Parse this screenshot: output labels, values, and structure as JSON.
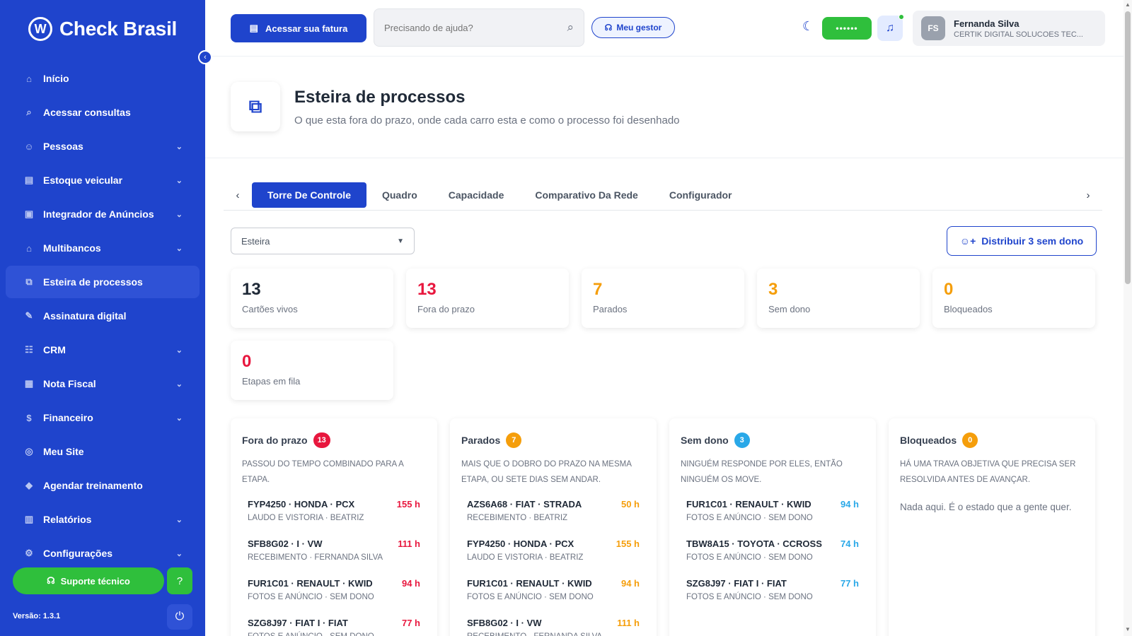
{
  "brand": {
    "name": "Check Brasil",
    "logo_letter": "W"
  },
  "sidebar": {
    "items": [
      {
        "label": "Início",
        "icon": "home-icon",
        "glyph": "⌂",
        "has_chevron": false,
        "active": false
      },
      {
        "label": "Acessar consultas",
        "icon": "search-icon",
        "glyph": "⌕",
        "has_chevron": false,
        "active": false
      },
      {
        "label": "Pessoas",
        "icon": "people-icon",
        "glyph": "☺",
        "has_chevron": true,
        "active": false
      },
      {
        "label": "Estoque veicular",
        "icon": "car-icon",
        "glyph": "▤",
        "has_chevron": true,
        "active": false
      },
      {
        "label": "Integrador de Anúncios",
        "icon": "ads-icon",
        "glyph": "▣",
        "has_chevron": true,
        "active": false
      },
      {
        "label": "Multibancos",
        "icon": "bank-icon",
        "glyph": "⌂",
        "has_chevron": true,
        "active": false
      },
      {
        "label": "Esteira de processos",
        "icon": "process-icon",
        "glyph": "⧉",
        "has_chevron": false,
        "active": true
      },
      {
        "label": "Assinatura digital",
        "icon": "signature-icon",
        "glyph": "✎",
        "has_chevron": false,
        "active": false
      },
      {
        "label": "CRM",
        "icon": "crm-icon",
        "glyph": "☷",
        "has_chevron": true,
        "active": false
      },
      {
        "label": "Nota Fiscal",
        "icon": "invoice-icon",
        "glyph": "▦",
        "has_chevron": true,
        "active": false
      },
      {
        "label": "Financeiro",
        "icon": "finance-icon",
        "glyph": "$",
        "has_chevron": true,
        "active": false
      },
      {
        "label": "Meu Site",
        "icon": "globe-icon",
        "glyph": "◎",
        "has_chevron": false,
        "active": false
      },
      {
        "label": "Agendar treinamento",
        "icon": "training-icon",
        "glyph": "◆",
        "has_chevron": false,
        "active": false
      },
      {
        "label": "Relatórios",
        "icon": "reports-icon",
        "glyph": "▥",
        "has_chevron": true,
        "active": false
      },
      {
        "label": "Configurações",
        "icon": "settings-icon",
        "glyph": "⚙",
        "has_chevron": true,
        "active": false
      }
    ],
    "support_label": "Suporte técnico",
    "version": "Versão: 1.3.1"
  },
  "topbar": {
    "invoice_label": "Acessar sua fatura",
    "search_placeholder": "Precisando de ajuda?",
    "manager_label": "Meu gestor",
    "masked_value": "••••••",
    "user": {
      "initials": "FS",
      "name": "Fernanda Silva",
      "company": "CERTIK DIGITAL SOLUCOES TEC..."
    }
  },
  "page": {
    "title": "Esteira de processos",
    "subtitle": "O que esta fora do prazo, onde cada carro esta e como o processo foi desenhado"
  },
  "tabs": [
    "Torre De Controle",
    "Quadro",
    "Capacidade",
    "Comparativo Da Rede",
    "Configurador"
  ],
  "active_tab": 0,
  "filters": {
    "select_value": "Esteira",
    "distribute_label": "Distribuir 3 sem dono"
  },
  "colors": {
    "primary": "#1f44cc",
    "green": "#2fbf3c",
    "red": "#e8173e",
    "orange": "#f59e0b",
    "blue": "#29a8e8",
    "dark": "#1f2937"
  },
  "kpis": [
    {
      "value": "13",
      "label": "Cartões vivos",
      "color": "#1f2937"
    },
    {
      "value": "13",
      "label": "Fora do prazo",
      "color": "#e8173e"
    },
    {
      "value": "7",
      "label": "Parados",
      "color": "#f59e0b"
    },
    {
      "value": "3",
      "label": "Sem dono",
      "color": "#f59e0b"
    },
    {
      "value": "0",
      "label": "Bloqueados",
      "color": "#f59e0b"
    },
    {
      "value": "0",
      "label": "Etapas em fila",
      "color": "#e8173e"
    }
  ],
  "columns": [
    {
      "title": "Fora do prazo",
      "count": "13",
      "color": "#e8173e",
      "desc": "Passou do tempo combinado para a etapa.",
      "items": [
        {
          "title": "FYP4250 · HONDA · PCX",
          "sub": "LAUDO E VISTORIA · BEATRIZ",
          "hours": "155 h"
        },
        {
          "title": "SFB8G02 · I · VW",
          "sub": "RECEBIMENTO · FERNANDA SILVA",
          "hours": "111 h"
        },
        {
          "title": "FUR1C01 · RENAULT · KWID",
          "sub": "FOTOS E ANÚNCIO · SEM DONO",
          "hours": "94 h"
        },
        {
          "title": "SZG8J97 · FIAT I · FIAT",
          "sub": "FOTOS E ANÚNCIO · SEM DONO",
          "hours": "77 h"
        }
      ],
      "empty": ""
    },
    {
      "title": "Parados",
      "count": "7",
      "color": "#f59e0b",
      "desc": "Mais que o dobro do prazo na mesma etapa, ou sete dias sem andar.",
      "items": [
        {
          "title": "AZS6A68 · FIAT · STRADA",
          "sub": "RECEBIMENTO · BEATRIZ",
          "hours": "50 h"
        },
        {
          "title": "FYP4250 · HONDA · PCX",
          "sub": "LAUDO E VISTORIA · BEATRIZ",
          "hours": "155 h"
        },
        {
          "title": "FUR1C01 · RENAULT · KWID",
          "sub": "FOTOS E ANÚNCIO · SEM DONO",
          "hours": "94 h"
        },
        {
          "title": "SFB8G02 · I · VW",
          "sub": "RECEBIMENTO · FERNANDA SILVA",
          "hours": "111 h"
        }
      ],
      "empty": ""
    },
    {
      "title": "Sem dono",
      "count": "3",
      "color": "#29a8e8",
      "desc": "Ninguém responde por eles, então ninguém os move.",
      "items": [
        {
          "title": "FUR1C01 · RENAULT · KWID",
          "sub": "FOTOS E ANÚNCIO · SEM DONO",
          "hours": "94 h"
        },
        {
          "title": "TBW8A15 · TOYOTA · CCROSS",
          "sub": "FOTOS E ANÚNCIO · SEM DONO",
          "hours": "74 h"
        },
        {
          "title": "SZG8J97 · FIAT I · FIAT",
          "sub": "FOTOS E ANÚNCIO · SEM DONO",
          "hours": "77 h"
        }
      ],
      "empty": ""
    },
    {
      "title": "Bloqueados",
      "count": "0",
      "color": "#f59e0b",
      "desc": "Há uma trava objetiva que precisa ser resolvida antes de avançar.",
      "items": [],
      "empty": "Nada aqui. É o estado que a gente quer."
    }
  ]
}
